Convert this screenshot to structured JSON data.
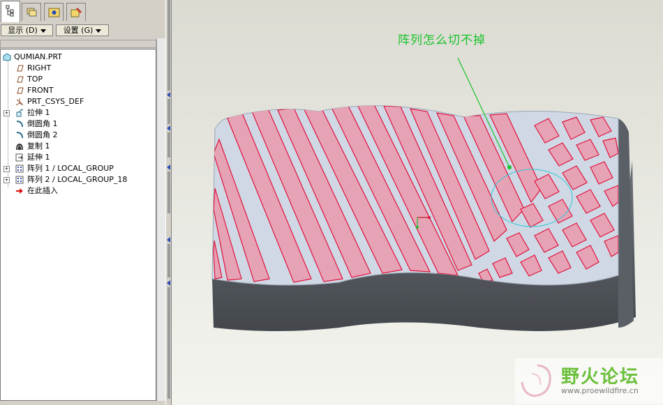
{
  "toolbar": {
    "show_label": "显示 (D)",
    "settings_label": "设置 (G)"
  },
  "tree": {
    "items": [
      {
        "label": "QUMIAN.PRT",
        "icon": "part-icon"
      },
      {
        "label": "RIGHT",
        "icon": "datum-plane-icon"
      },
      {
        "label": "TOP",
        "icon": "datum-plane-icon"
      },
      {
        "label": "FRONT",
        "icon": "datum-plane-icon"
      },
      {
        "label": "PRT_CSYS_DEF",
        "icon": "coordinate-system-icon"
      },
      {
        "label": "拉伸 1",
        "icon": "extrude-icon"
      },
      {
        "label": "倒圆角 1",
        "icon": "round-icon"
      },
      {
        "label": "倒圆角 2",
        "icon": "round-icon"
      },
      {
        "label": "复制 1",
        "icon": "copy-surface-icon"
      },
      {
        "label": "延伸 1",
        "icon": "extend-icon"
      },
      {
        "label": "阵列 1 / LOCAL_GROUP",
        "icon": "pattern-icon"
      },
      {
        "label": "阵列 2 / LOCAL_GROUP_18",
        "icon": "pattern-icon"
      },
      {
        "label": "在此插入",
        "icon": "insert-here-arrow-icon"
      }
    ]
  },
  "viewport": {
    "annotation": "阵列怎么切不掉"
  },
  "watermark": {
    "title": "野火论坛",
    "url": "www.proewildfire.cn"
  },
  "colors": {
    "cut_fill": "#e7a3b6",
    "cut_edge": "#e0123c",
    "annotation": "#19c22a",
    "highlight_circle": "#2ec8d8"
  }
}
